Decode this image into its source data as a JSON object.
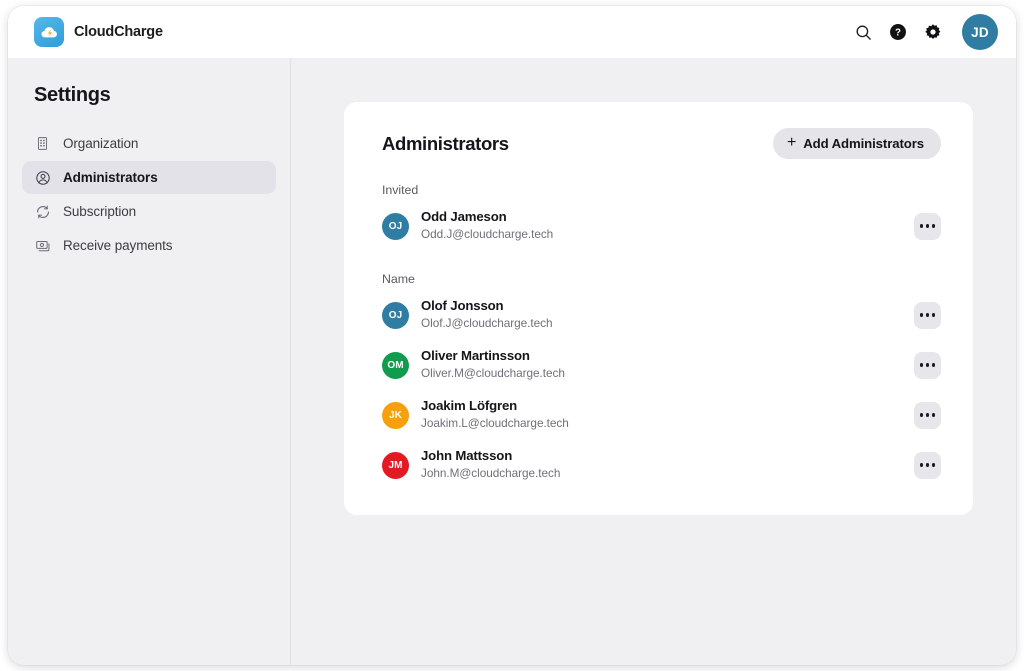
{
  "brand": {
    "name": "CloudCharge",
    "logo_icon": "cloud-bolt-icon"
  },
  "topbar": {
    "search_icon": "search-icon",
    "help_icon": "help-circle-icon",
    "settings_icon": "gear-icon",
    "avatar_initials": "JD",
    "avatar_color": "#2f7da3"
  },
  "sidebar": {
    "title": "Settings",
    "items": [
      {
        "label": "Organization",
        "icon": "building-icon",
        "active": false
      },
      {
        "label": "Administrators",
        "icon": "user-circle-icon",
        "active": true
      },
      {
        "label": "Subscription",
        "icon": "refresh-cycle-icon",
        "active": false
      },
      {
        "label": "Receive payments",
        "icon": "banknotes-icon",
        "active": false
      }
    ]
  },
  "card": {
    "title": "Administrators",
    "add_button": {
      "label": "Add Administrators",
      "icon": "plus-icon"
    },
    "invited_label": "Invited",
    "name_label": "Name",
    "more_icon": "ellipsis-icon",
    "invited": [
      {
        "initials": "OJ",
        "name": "Odd Jameson",
        "email": "Odd.J@cloudcharge.tech",
        "color": "#2f7da3"
      }
    ],
    "members": [
      {
        "initials": "OJ",
        "name": "Olof Jonsson",
        "email": "Olof.J@cloudcharge.tech",
        "color": "#2f7da3"
      },
      {
        "initials": "OM",
        "name": "Oliver Martinsson",
        "email": "Oliver.M@cloudcharge.tech",
        "color": "#109c4c"
      },
      {
        "initials": "JK",
        "name": "Joakim Löfgren",
        "email": "Joakim.L@cloudcharge.tech",
        "color": "#f79f0c"
      },
      {
        "initials": "JM",
        "name": "John Mattsson",
        "email": "John.M@cloudcharge.tech",
        "color": "#e01b24"
      }
    ]
  }
}
